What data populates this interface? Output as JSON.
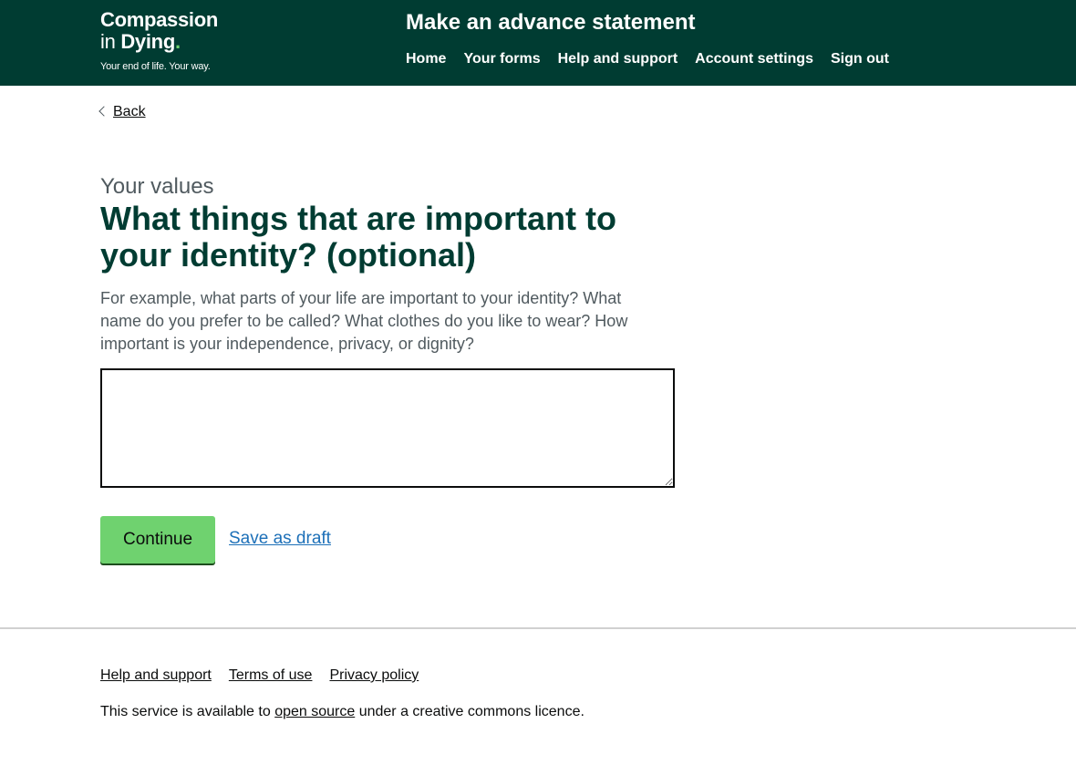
{
  "header": {
    "logo": {
      "line1": "Compassion",
      "line2_prefix": "in",
      "line2_bold": "Dying",
      "dot": ".",
      "tagline": "Your end of life. Your way."
    },
    "service_name": "Make an advance statement",
    "nav": [
      {
        "label": "Home"
      },
      {
        "label": "Your forms"
      },
      {
        "label": "Help and support"
      },
      {
        "label": "Account settings"
      },
      {
        "label": "Sign out"
      }
    ]
  },
  "back_link": {
    "label": "Back"
  },
  "main": {
    "caption": "Your values",
    "heading": "What things that are important to your identity? (optional)",
    "hint": "For example, what parts of your life are important to your identity? What name do you prefer to be called? What clothes do you like to wear? How important is your independence, privacy, or dignity?",
    "textarea_value": "",
    "continue_label": "Continue",
    "save_draft_label": "Save as draft"
  },
  "footer": {
    "links": [
      {
        "label": "Help and support"
      },
      {
        "label": "Terms of use"
      },
      {
        "label": "Privacy policy"
      }
    ],
    "licence_prefix": "This service is available to ",
    "licence_link": "open source",
    "licence_suffix": " under a creative commons licence."
  },
  "colors": {
    "header_bg": "#003c32",
    "accent_green": "#6fd26f",
    "heading_color": "#003c32",
    "link_blue": "#1d70b8"
  }
}
